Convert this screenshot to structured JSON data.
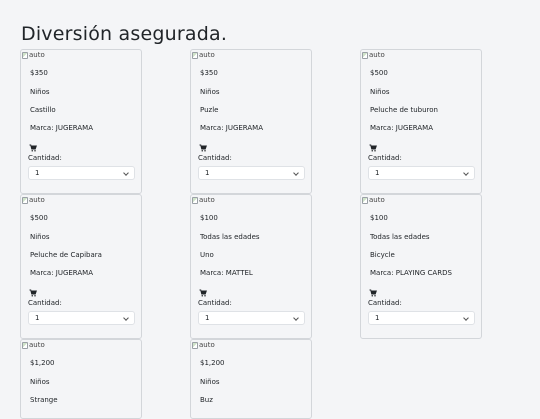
{
  "page": {
    "title": "Diversión asegurada."
  },
  "labels": {
    "quantity": "Cantidad:",
    "img_alt": "auto"
  },
  "products": [
    {
      "price": "$350",
      "age": "Niños",
      "name": "Castillo",
      "brand": "Marca: JUGERAMA",
      "qty": "1"
    },
    {
      "price": "$350",
      "age": "Niños",
      "name": "Puzle",
      "brand": "Marca: JUGERAMA",
      "qty": "1"
    },
    {
      "price": "$500",
      "age": "Niños",
      "name": "Peluche de tuburon",
      "brand": "Marca: JUGERAMA",
      "qty": "1"
    },
    {
      "price": "$500",
      "age": "Niños",
      "name": "Peluche de Capibara",
      "brand": "Marca: JUGERAMA",
      "qty": "1"
    },
    {
      "price": "$100",
      "age": "Todas las edades",
      "name": "Uno",
      "brand": "Marca: MATTEL",
      "qty": "1"
    },
    {
      "price": "$100",
      "age": "Todas las edades",
      "name": "Bicycle",
      "brand": "Marca: PLAYING CARDS",
      "qty": "1"
    },
    {
      "price": "$1,200",
      "age": "Niños",
      "name": "Strange"
    },
    {
      "price": "$1,200",
      "age": "Niños",
      "name": "Buz"
    }
  ],
  "icons": {
    "cart": "cart-icon",
    "dropdown": "chevron-down-icon",
    "broken_image": "broken-image-icon"
  }
}
